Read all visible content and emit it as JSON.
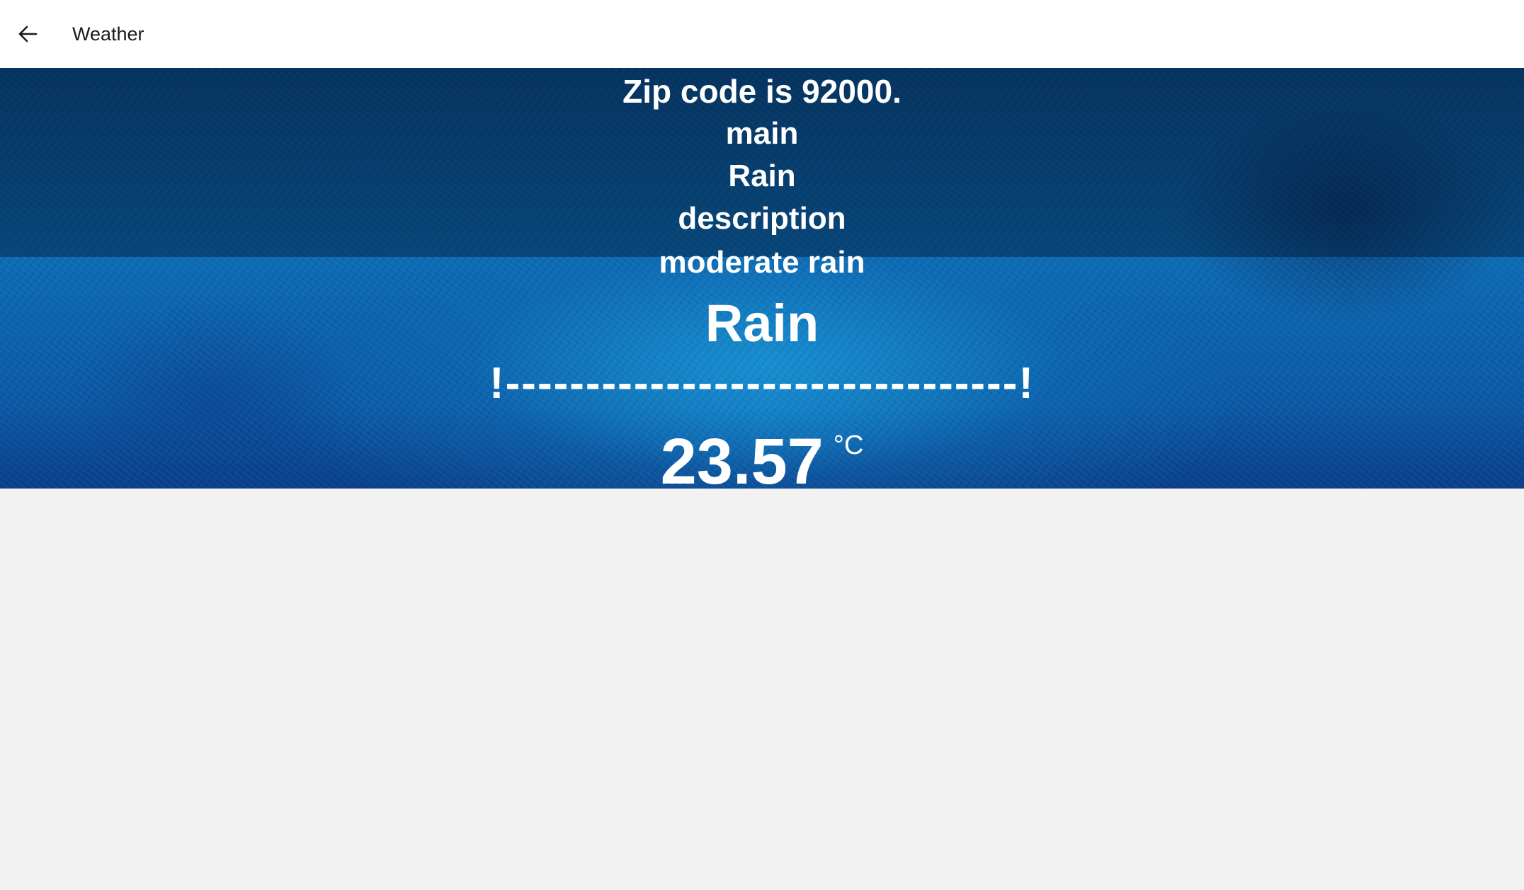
{
  "header": {
    "back_icon": "arrow-left-icon",
    "title": "Weather"
  },
  "weather": {
    "zip_line": "Zip code is 92000.",
    "main_label": "main",
    "main_value": "Rain",
    "description_label": "description",
    "description_value": "moderate rain",
    "condition_heading": "Rain",
    "separator": "!--------------------------------!",
    "temperature": "23.57",
    "temperature_unit": "°C"
  },
  "colors": {
    "hero_blue": "#0e6cb5",
    "page_background": "#f2f2f2",
    "header_background": "#ffffff"
  }
}
